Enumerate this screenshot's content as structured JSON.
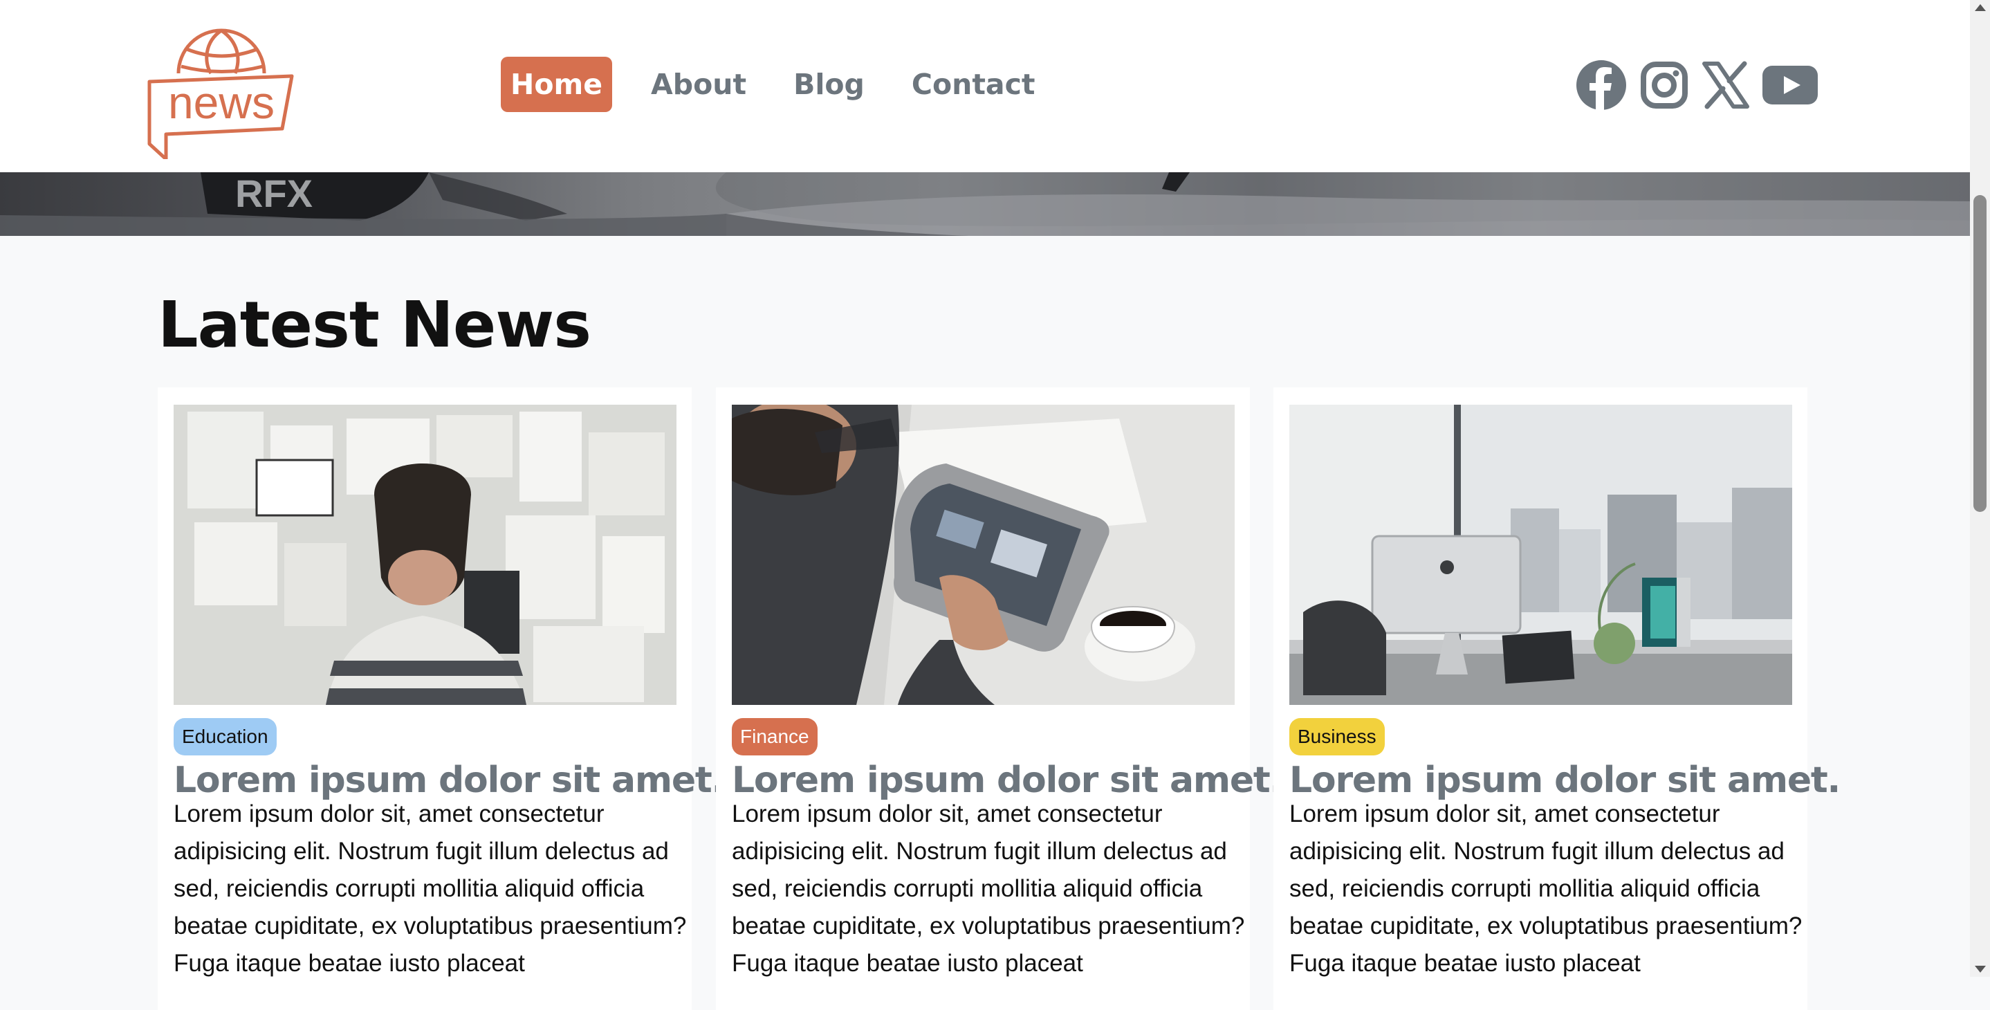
{
  "brand": {
    "logo_text": "news",
    "accent": "#d6704f"
  },
  "nav": {
    "items": [
      {
        "label": "Home",
        "active": true
      },
      {
        "label": "About",
        "active": false
      },
      {
        "label": "Blog",
        "active": false
      },
      {
        "label": "Contact",
        "active": false
      }
    ]
  },
  "social": [
    "facebook-icon",
    "instagram-icon",
    "x-icon",
    "youtube-icon"
  ],
  "main": {
    "section_title": "Latest News",
    "cards": [
      {
        "category": "Education",
        "category_color": "#9ecbf4",
        "title": "Lorem ipsum dolor sit amet.",
        "body": "Lorem ipsum dolor sit, amet consectetur adipisicing elit. Nostrum fugit illum delectus ad sed, reiciendis corrupti mollitia aliquid officia beatae cupiditate, ex voluptatibus praesentium? Fuga itaque beatae iusto placeat"
      },
      {
        "category": "Finance",
        "category_color": "#d6704f",
        "title": "Lorem ipsum dolor sit amet.",
        "body": "Lorem ipsum dolor sit, amet consectetur adipisicing elit. Nostrum fugit illum delectus ad sed, reiciendis corrupti mollitia aliquid officia beatae cupiditate, ex voluptatibus praesentium? Fuga itaque beatae iusto placeat"
      },
      {
        "category": "Business",
        "category_color": "#f2d13d",
        "title": "Lorem ipsum dolor sit amet.",
        "body": "Lorem ipsum dolor sit, amet consectetur adipisicing elit. Nostrum fugit illum delectus ad sed, reiciendis corrupti mollitia aliquid officia beatae cupiditate, ex voluptatibus praesentium? Fuga itaque beatae iusto placeat"
      }
    ]
  }
}
